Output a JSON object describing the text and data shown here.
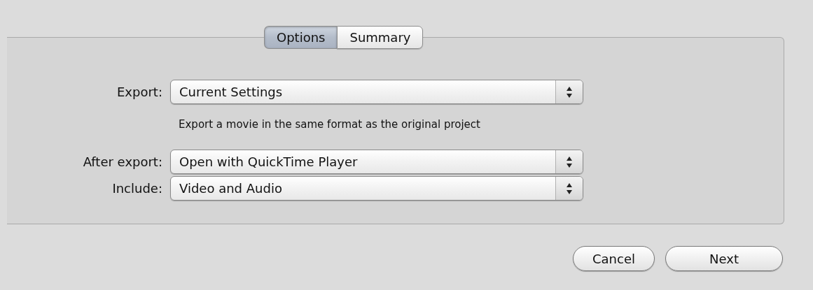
{
  "tabs": [
    {
      "label": "Options",
      "selected": true
    },
    {
      "label": "Summary",
      "selected": false
    }
  ],
  "fields": [
    {
      "label": "Export:",
      "value": "Current Settings",
      "note": "Export a movie in the same format as the original project"
    },
    {
      "label": "After export:",
      "value": "Open with QuickTime Player"
    },
    {
      "label": "Include:",
      "value": "Video and Audio"
    }
  ],
  "buttons": [
    {
      "label": "Cancel"
    },
    {
      "label": "Next"
    }
  ]
}
